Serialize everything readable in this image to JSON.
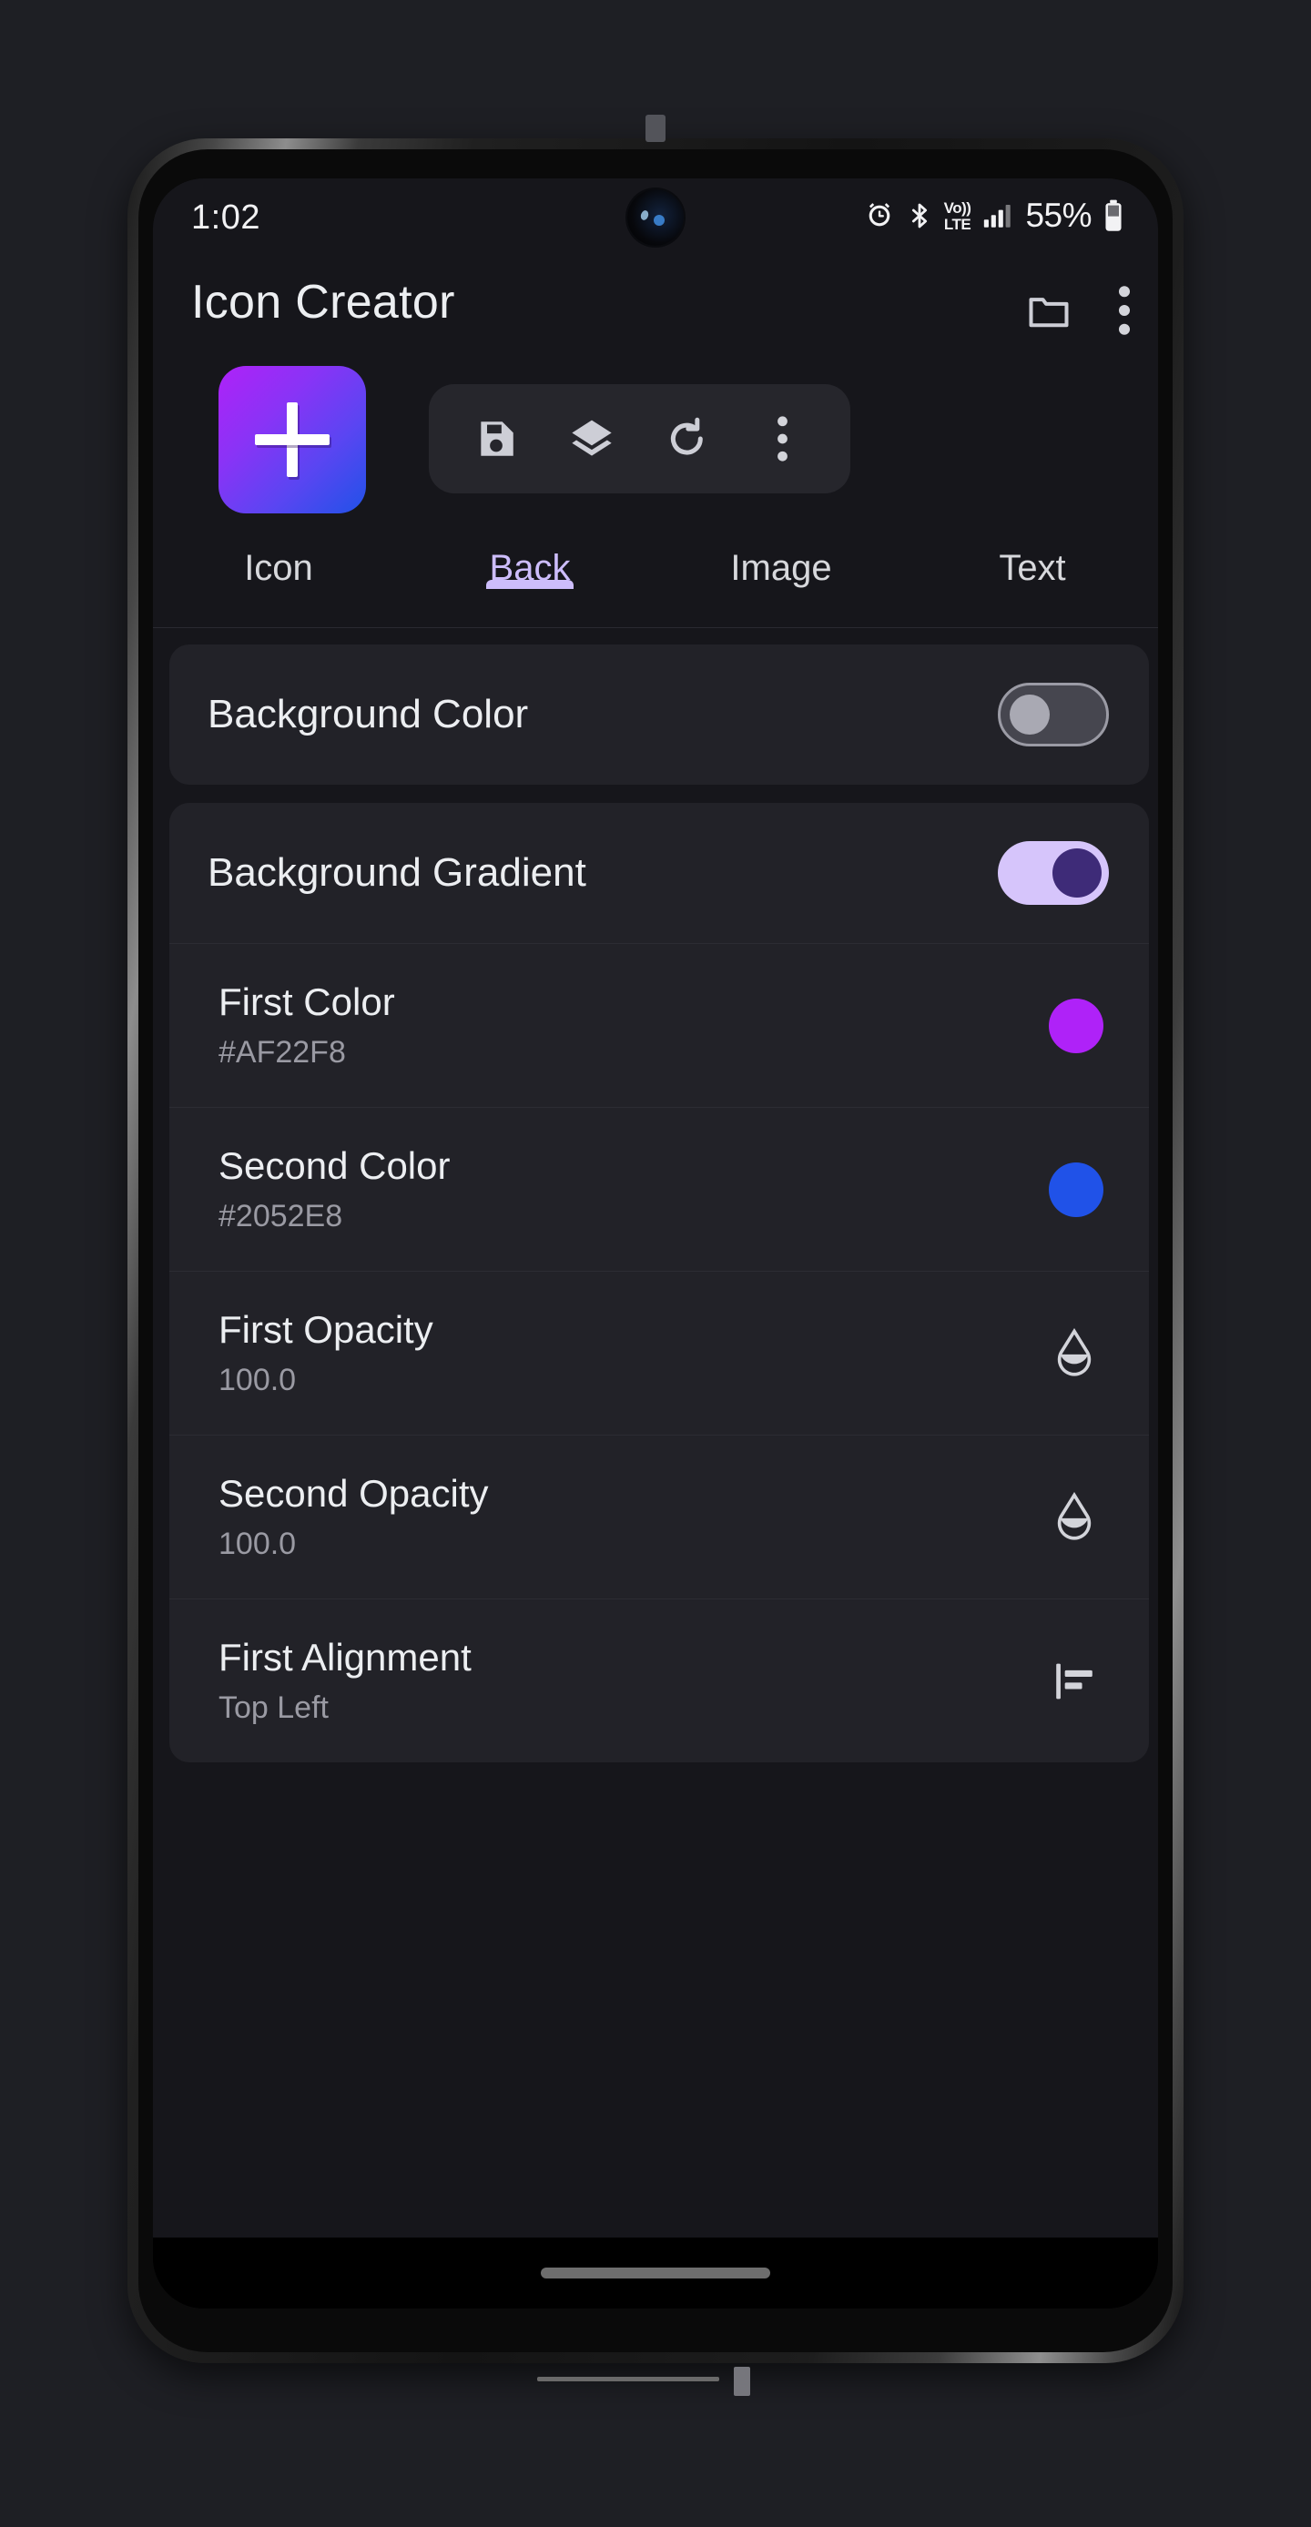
{
  "status_bar": {
    "time": "1:02",
    "battery_percent": "55%",
    "icons": [
      "alarm-icon",
      "bluetooth-icon",
      "volte-icon",
      "signal-bars-icon",
      "battery-icon"
    ],
    "volte_top": "Vo))",
    "volte_bottom": "LTE"
  },
  "app_bar": {
    "title": "Icon Creator",
    "actions": [
      "folder-icon",
      "overflow-menu-icon"
    ]
  },
  "preview": {
    "icon_plus_label": "+",
    "gradient_start": "#AF22F8",
    "gradient_end": "#2052E8",
    "toolbar": [
      "save-icon",
      "layers-icon",
      "refresh-icon",
      "overflow-menu-icon"
    ]
  },
  "tabs": {
    "active_index": 1,
    "items": [
      {
        "label": "Icon"
      },
      {
        "label": "Back"
      },
      {
        "label": "Image"
      },
      {
        "label": "Text"
      }
    ],
    "active_color": "#CDBDFB"
  },
  "settings": {
    "background_color": {
      "label": "Background Color",
      "enabled": false
    },
    "background_gradient": {
      "label": "Background Gradient",
      "enabled": true,
      "rows": [
        {
          "label": "First Color",
          "value": "#AF22F8",
          "icon": "color-swatch-icon",
          "swatch_color": "#AF22F8"
        },
        {
          "label": "Second Color",
          "value": "#2052E8",
          "icon": "color-swatch-icon",
          "swatch_color": "#2052E8"
        },
        {
          "label": "First Opacity",
          "value": "100.0",
          "icon": "opacity-droplet-icon"
        },
        {
          "label": "Second Opacity",
          "value": "100.0",
          "icon": "opacity-droplet-icon"
        },
        {
          "label": "First Alignment",
          "value": "Top Left",
          "icon": "align-left-icon"
        }
      ]
    }
  },
  "navigation": {
    "gesture_pill": "home-gesture-pill"
  }
}
